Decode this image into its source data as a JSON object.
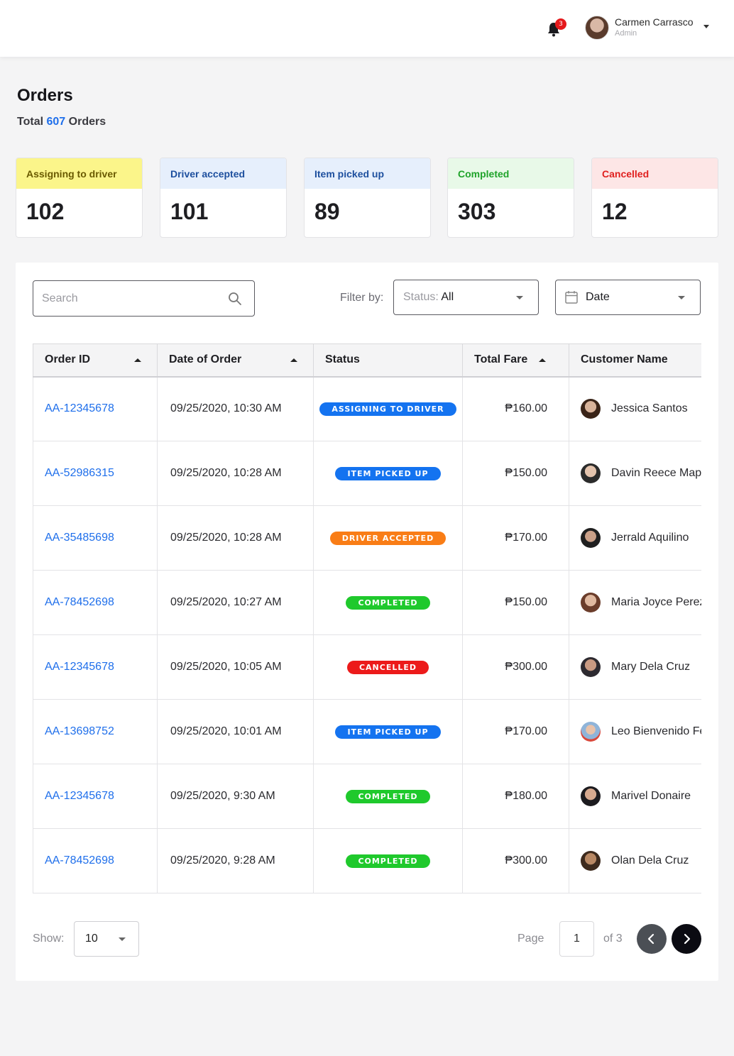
{
  "header": {
    "notification_count": "3",
    "user_name": "Carmen Carrasco",
    "user_role": "Admin"
  },
  "page": {
    "title": "Orders",
    "subtitle_prefix": "Total",
    "total": "607",
    "subtitle_suffix": "Orders"
  },
  "summary_cards": [
    {
      "label": "Assigning to driver",
      "value": "102",
      "bg": "#fbf58a",
      "color": "#6a5a00"
    },
    {
      "label": "Driver accepted",
      "value": "101",
      "bg": "#e6effc",
      "color": "#1d4f9e"
    },
    {
      "label": "Item picked up",
      "value": "89",
      "bg": "#e6effc",
      "color": "#1d4f9e"
    },
    {
      "label": "Completed",
      "value": "303",
      "bg": "#e8f9e8",
      "color": "#1fa32a"
    },
    {
      "label": "Cancelled",
      "value": "12",
      "bg": "#fde6e6",
      "color": "#e0201f"
    }
  ],
  "toolbar": {
    "search_placeholder": "Search",
    "filter_label": "Filter by:",
    "status_prefix": "Status:",
    "status_value": "All",
    "date_label": "Date"
  },
  "table": {
    "columns": [
      "Order ID",
      "Date of Order",
      "Status",
      "Total Fare",
      "Customer Name"
    ],
    "rows": [
      {
        "id": "AA-12345678",
        "date": "09/25/2020, 10:30 AM",
        "status": "ASSIGNING TO DRIVER",
        "status_color": "#1473f0",
        "fare": "₱160.00",
        "customer": "Jessica Santos"
      },
      {
        "id": "AA-52986315",
        "date": "09/25/2020, 10:28 AM",
        "status": "ITEM PICKED UP",
        "status_color": "#1473f0",
        "fare": "₱150.00",
        "customer": "Davin Reece Mapalad"
      },
      {
        "id": "AA-35485698",
        "date": "09/25/2020, 10:28 AM",
        "status": "DRIVER ACCEPTED",
        "status_color": "#f97d16",
        "fare": "₱170.00",
        "customer": "Jerrald Aquilino"
      },
      {
        "id": "AA-78452698",
        "date": "09/25/2020, 10:27 AM",
        "status": "COMPLETED",
        "status_color": "#1fc92c",
        "fare": "₱150.00",
        "customer": "Maria Joyce Perez"
      },
      {
        "id": "AA-12345678",
        "date": "09/25/2020, 10:05 AM",
        "status": "CANCELLED",
        "status_color": "#ec1a1a",
        "fare": "₱300.00",
        "customer": "Mary Dela Cruz"
      },
      {
        "id": "AA-13698752",
        "date": "09/25/2020, 10:01 AM",
        "status": "ITEM PICKED UP",
        "status_color": "#1473f0",
        "fare": "₱170.00",
        "customer": "Leo Bienvenido Fernandez"
      },
      {
        "id": "AA-12345678",
        "date": "09/25/2020, 9:30 AM",
        "status": "COMPLETED",
        "status_color": "#1fc92c",
        "fare": "₱180.00",
        "customer": "Marivel Donaire"
      },
      {
        "id": "AA-78452698",
        "date": "09/25/2020, 9:28 AM",
        "status": "COMPLETED",
        "status_color": "#1fc92c",
        "fare": "₱300.00",
        "customer": "Olan Dela Cruz"
      }
    ]
  },
  "pagination": {
    "show_label": "Show:",
    "page_size": "10",
    "page_label": "Page",
    "current_page": "1",
    "of_label": "of 3"
  }
}
